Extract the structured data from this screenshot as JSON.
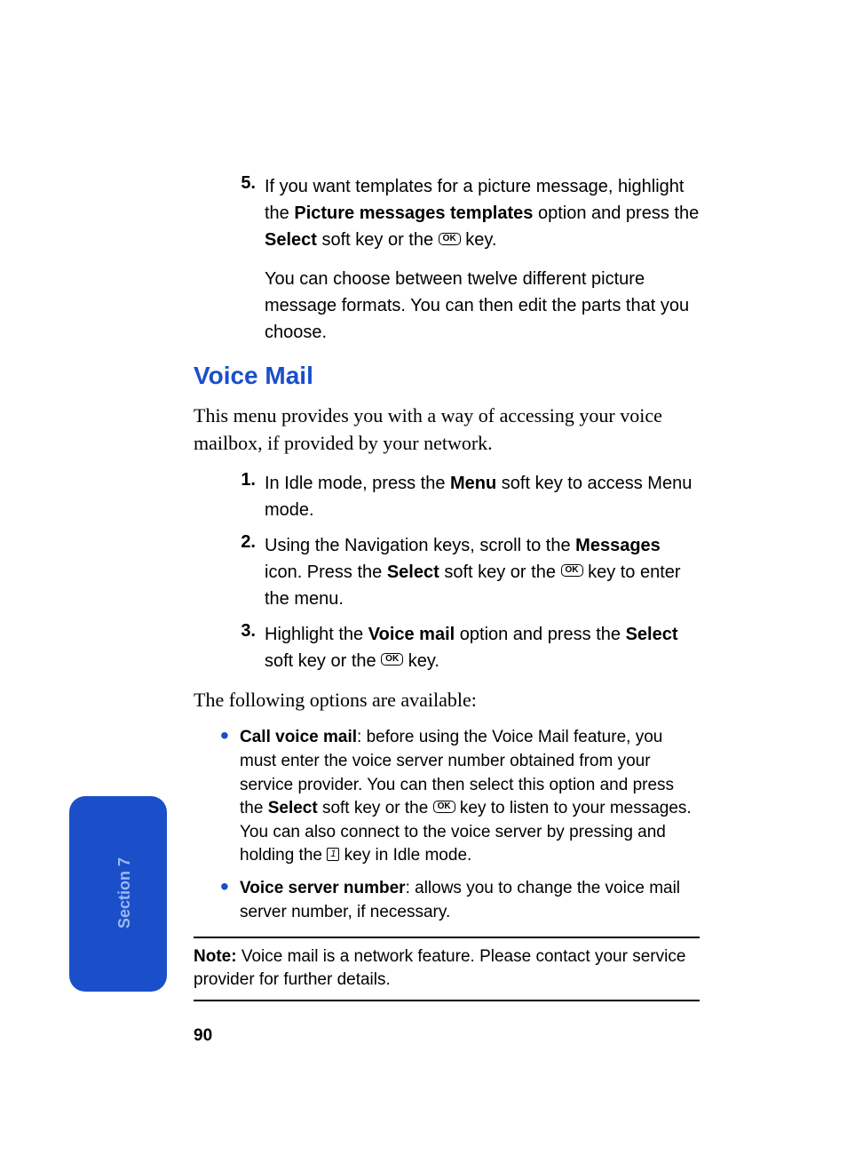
{
  "sideTab": {
    "label": "Section 7"
  },
  "pageNumber": "90",
  "step5": {
    "num": "5.",
    "part1a": "If you want templates for a picture message, highlight the ",
    "bold1": "Picture messages templates",
    "part1b": " option and press the ",
    "bold2": "Select",
    "part1c": " soft key or the ",
    "key1": "OK",
    "part1d": " key.",
    "para2": "You can choose between twelve different picture message formats. You can then edit the parts that you choose."
  },
  "heading": "Voice Mail",
  "intro": "This menu provides you with a way of accessing your voice mailbox, if provided by your network.",
  "steps": [
    {
      "num": "1.",
      "a": "In Idle mode, press the ",
      "b1": "Menu",
      "c": " soft key to access Menu mode."
    },
    {
      "num": "2.",
      "a": "Using the Navigation keys, scroll to the ",
      "b1": "Messages",
      "c": " icon. Press the ",
      "b2": "Select",
      "d": " soft key or the ",
      "key": "OK",
      "e": " key to enter the menu."
    },
    {
      "num": "3.",
      "a": "Highlight the ",
      "b1": "Voice mail",
      "c": " option and press the ",
      "b2": "Select",
      "d": " soft key or the ",
      "key": "OK",
      "e": " key."
    }
  ],
  "followup": "The following options are available:",
  "bullets": [
    {
      "label": "Call voice mail",
      "a": ": before using the Voice Mail feature, you must enter the voice server number obtained from your service provider. You can then select this option and press the ",
      "b1": "Select",
      "c": " soft key or the ",
      "key1": "OK",
      "d": " key to listen to your messages. You can also connect to the voice server by pressing and holding the ",
      "key2": "1",
      "e": " key in Idle mode."
    },
    {
      "label": "Voice server number",
      "a": ": allows you to change the voice mail server number, if necessary."
    }
  ],
  "note": {
    "label": "Note:",
    "text": " Voice mail is a network feature. Please contact your service provider for further details."
  }
}
